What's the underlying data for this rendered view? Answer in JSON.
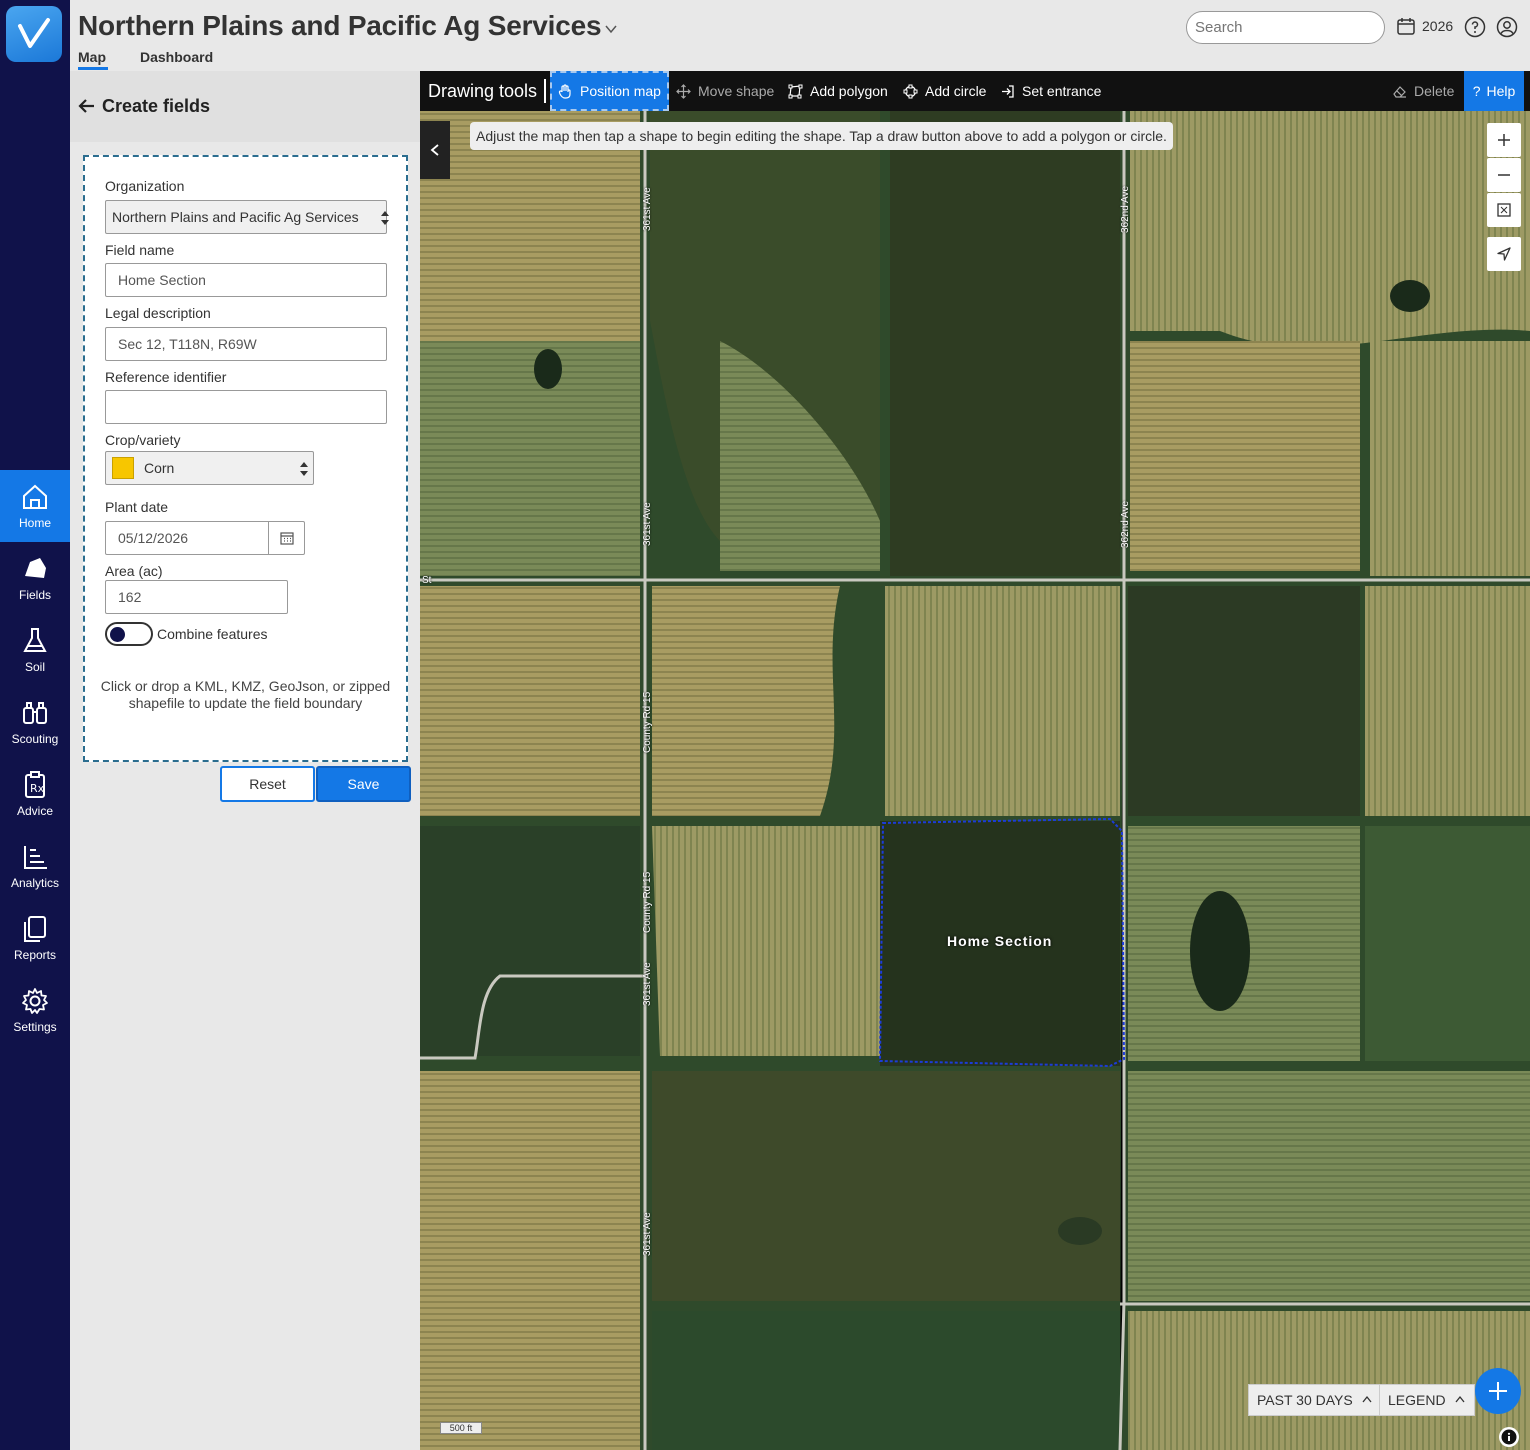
{
  "header": {
    "org_title": "Northern Plains and Pacific Ag Services",
    "tabs": [
      "Map",
      "Dashboard"
    ],
    "search_placeholder": "Search",
    "year": "2026"
  },
  "nav": {
    "items": [
      {
        "label": "Home",
        "icon": "home-icon",
        "active": true
      },
      {
        "label": "Fields",
        "icon": "fields-icon"
      },
      {
        "label": "Soil",
        "icon": "flask-icon"
      },
      {
        "label": "Scouting",
        "icon": "binoculars-icon"
      },
      {
        "label": "Advice",
        "icon": "prescription-icon"
      },
      {
        "label": "Analytics",
        "icon": "chart-icon"
      },
      {
        "label": "Reports",
        "icon": "documents-icon"
      },
      {
        "label": "Settings",
        "icon": "gear-icon"
      }
    ]
  },
  "panel": {
    "title": "Create fields",
    "organization_label": "Organization",
    "organization_value": "Northern Plains and Pacific Ag Services",
    "field_name_label": "Field name",
    "field_name_value": "Home Section",
    "legal_label": "Legal description",
    "legal_value": "Sec 12, T118N, R69W",
    "ref_label": "Reference identifier",
    "ref_value": "",
    "crop_label": "Crop/variety",
    "crop_value": "Corn",
    "crop_color": "#f7c600",
    "plant_date_label": "Plant date",
    "plant_date_value": "05/12/2026",
    "area_label": "Area (ac)",
    "area_value": "162",
    "combine_label": "Combine features",
    "combine_on": false,
    "drop_text": "Click or drop a KML, KMZ, GeoJson, or zipped shapefile to update the field boundary",
    "reset_label": "Reset",
    "save_label": "Save"
  },
  "toolbar": {
    "title": "Drawing tools",
    "position_map": "Position map",
    "move_shape": "Move shape",
    "add_polygon": "Add polygon",
    "add_circle": "Add circle",
    "set_entrance": "Set entrance",
    "delete": "Delete",
    "help": "Help"
  },
  "map": {
    "hint": "Adjust the map then tap a shape to begin editing the shape. Tap a draw button above to add a polygon or circle.",
    "field_label": "Home Section",
    "roads": [
      "361st Ave",
      "362nd Ave",
      "County Rd 15",
      "St"
    ],
    "scale": "500 ft",
    "period_button": "PAST 30 DAYS",
    "legend_button": "LEGEND",
    "accent_color": "#1478e6"
  }
}
